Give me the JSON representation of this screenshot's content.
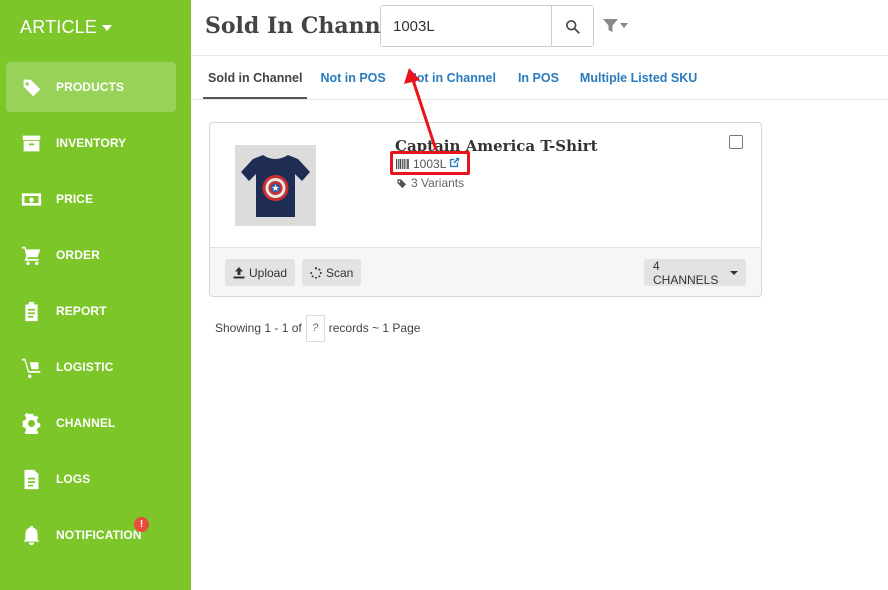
{
  "sidebar": {
    "brand": "ARTICLE",
    "items": [
      {
        "label": "PRODUCTS"
      },
      {
        "label": "INVENTORY"
      },
      {
        "label": "PRICE"
      },
      {
        "label": "ORDER"
      },
      {
        "label": "REPORT"
      },
      {
        "label": "LOGISTIC"
      },
      {
        "label": "CHANNEL"
      },
      {
        "label": "LOGS"
      },
      {
        "label": "NOTIFICATION",
        "badge": "!"
      }
    ]
  },
  "header": {
    "title": "Sold In Channel",
    "search_value": "1003L"
  },
  "tabs": [
    {
      "label": "Sold in Channel"
    },
    {
      "label": "Not in POS"
    },
    {
      "label": "Not in Channel"
    },
    {
      "label": "In POS"
    },
    {
      "label": "Multiple Listed SKU"
    }
  ],
  "product": {
    "name": "Captain America T-Shirt",
    "sku": "1003L",
    "variants": "3 Variants",
    "upload_label": "Upload",
    "scan_label": "Scan",
    "channels_label": "4 CHANNELS"
  },
  "paging": {
    "prefix": "Showing 1 - 1 of",
    "total": "?",
    "suffix": "records ~ 1 Page"
  },
  "colors": {
    "sidebar": "#7cc62a",
    "tab_link": "#2a7bbd",
    "annotation": "#e8141d"
  }
}
